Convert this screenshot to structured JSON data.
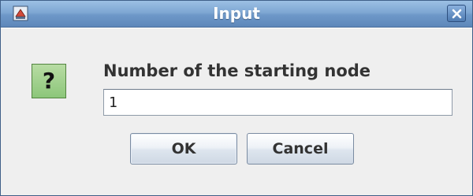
{
  "window": {
    "title": "Input"
  },
  "dialog": {
    "icon": "question-icon",
    "icon_glyph": "?",
    "prompt": "Number of the starting node",
    "input_value": "1"
  },
  "buttons": {
    "ok_label": "OK",
    "cancel_label": "Cancel"
  },
  "colors": {
    "titlebar": "#6e98c8",
    "question_icon_bg": "#8cc67a",
    "window_bg": "#efefef"
  }
}
